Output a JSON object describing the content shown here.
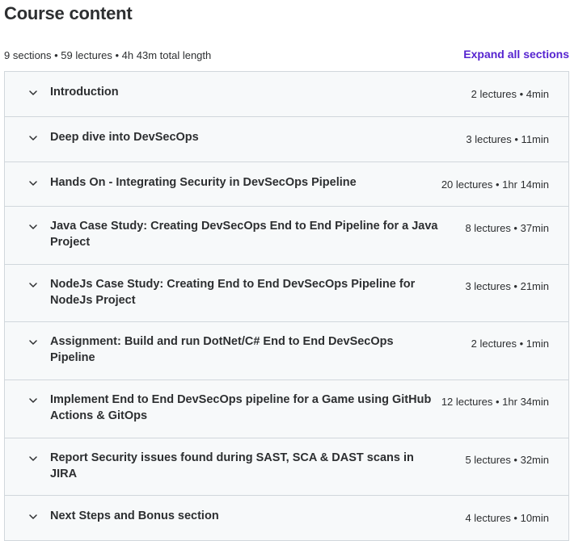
{
  "header": {
    "title": "Course content",
    "summary": "9 sections • 59 lectures • 4h 43m total length",
    "expand_label": "Expand all sections"
  },
  "icons": {
    "section_toggle": "chevron-down-icon"
  },
  "colors": {
    "accent": "#5624d0",
    "section_bg": "#f7f9fa",
    "border": "#d1d7dc",
    "text": "#2d2f31"
  },
  "sections": [
    {
      "title": "Introduction",
      "meta": "2 lectures • 4min"
    },
    {
      "title": "Deep dive into DevSecOps",
      "meta": "3 lectures • 11min"
    },
    {
      "title": "Hands On - Integrating Security in DevSecOps Pipeline",
      "meta": "20 lectures • 1hr 14min"
    },
    {
      "title": "Java Case Study: Creating DevSecOps End to End Pipeline for a Java Project",
      "meta": "8 lectures • 37min"
    },
    {
      "title": "NodeJs Case Study: Creating End to End DevSecOps Pipeline for NodeJs Project",
      "meta": "3 lectures • 21min"
    },
    {
      "title": "Assignment: Build and run DotNet/C# End to End DevSecOps Pipeline",
      "meta": "2 lectures • 1min"
    },
    {
      "title": "Implement End to End DevSecOps pipeline for a Game using GitHub Actions & GitOps",
      "meta": "12 lectures • 1hr 34min"
    },
    {
      "title": "Report Security issues found during SAST, SCA & DAST scans in JIRA",
      "meta": "5 lectures • 32min"
    },
    {
      "title": "Next Steps and Bonus section",
      "meta": "4 lectures • 10min"
    }
  ]
}
